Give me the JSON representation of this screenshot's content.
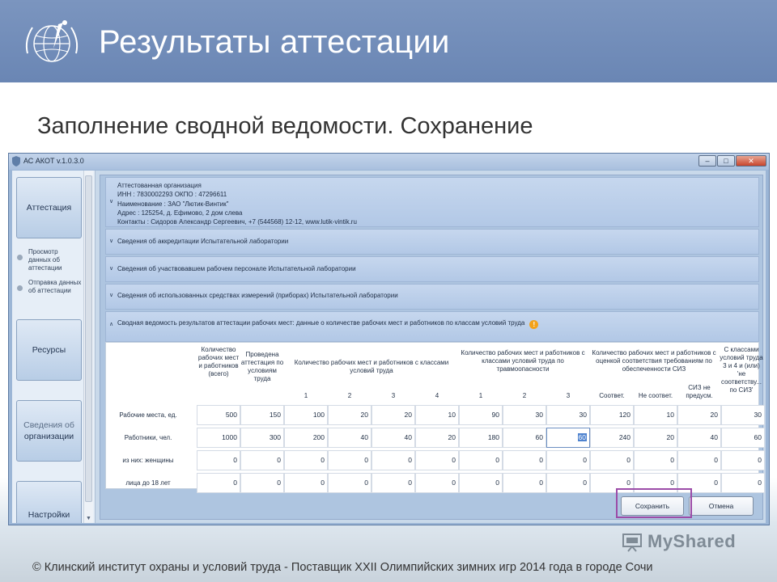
{
  "slide": {
    "title": "Результаты аттестации",
    "subtitle": "Заполнение сводной ведомости. Сохранение",
    "footer": "© Клинский институт охраны и условий труда - Поставщик XXII Олимпийских зимних игр 2014 года в городе Сочи",
    "watermark": "MyShared"
  },
  "window": {
    "title": "АС АКОТ v.1.0.3.0",
    "controls": [
      "minimize-icon",
      "maximize-icon",
      "close-icon"
    ]
  },
  "sidebar": {
    "attest_label": "Аттестация",
    "sub_view": "Просмотр данных об аттестации",
    "sub_send": "Отправка данных об аттестации",
    "resources_label": "Ресурсы",
    "org_line1": "Сведения об",
    "org_line2": "организации",
    "settings_label": "Настройки"
  },
  "panels": {
    "org_header": "Аттестованная организация",
    "org_inn": "ИНН : 7830002293  ОКПО : 47296611",
    "org_name": "Наименование : ЗАО \"Лютик-Винтик\"",
    "org_address": "Адрес : 125254, д. Ефимово, 2 дом слева",
    "org_contacts": "Контакты : Сидоров Александр Сергеевич, +7 (544568) 12-12, www.lutik-vintik.ru",
    "accreditation": "Сведения об аккредитации Испытательной лаборатории",
    "personnel": "Сведения об участвовавшем рабочем персонале Испытательной лаборатории",
    "instruments": "Сведения об использованных средствах измерений (приборах) Испытательной лаборатории",
    "summary": "Сводная ведомость результатов аттестации рабочих мест: данные о количестве рабочих мест и работников по классам условий труда"
  },
  "table": {
    "group_classes": "Количество рабочих мест и работников с классами условий труда",
    "group_injury": "Количество рабочих мест и работников с классами условий труда по травмоопасности",
    "group_ppe": "Количество рабочих мест и работников с оценкой соответствия требованиям по обеспеченности СИЗ",
    "group_ppe_class": "С классами условий труда 3 и 4 и (или) 'не соответству... по СИЗ'",
    "col_total": "Количество рабочих мест и работников (всего)",
    "col_certified": "Проведена аттестация по условиям труда",
    "class_cols": [
      "1",
      "2",
      "3",
      "4"
    ],
    "injury_cols": [
      "1",
      "2",
      "3"
    ],
    "ppe_cols": [
      "Соответ.",
      "Не соответ.",
      "СИЗ не предусм."
    ],
    "rows": [
      {
        "label": "Рабочие места, ед.",
        "values": [
          "500",
          "150",
          "100",
          "20",
          "20",
          "10",
          "90",
          "30",
          "30",
          "120",
          "10",
          "20",
          "30"
        ]
      },
      {
        "label": "Работники, чел.",
        "values": [
          "1000",
          "300",
          "200",
          "40",
          "40",
          "20",
          "180",
          "60",
          "60",
          "240",
          "20",
          "40",
          "60"
        ]
      },
      {
        "label": "из них: женщины",
        "values": [
          "0",
          "0",
          "0",
          "0",
          "0",
          "0",
          "0",
          "0",
          "0",
          "0",
          "0",
          "0",
          "0"
        ]
      },
      {
        "label": "лица до 18 лет",
        "values": [
          "0",
          "0",
          "0",
          "0",
          "0",
          "0",
          "0",
          "0",
          "0",
          "0",
          "0",
          "0",
          "0"
        ]
      }
    ]
  },
  "buttons": {
    "save": "Сохранить",
    "cancel": "Отмена"
  },
  "colors": {
    "header_band": "#6a86b4",
    "highlight": "#9c4ca8",
    "selection": "#4f83cf"
  }
}
